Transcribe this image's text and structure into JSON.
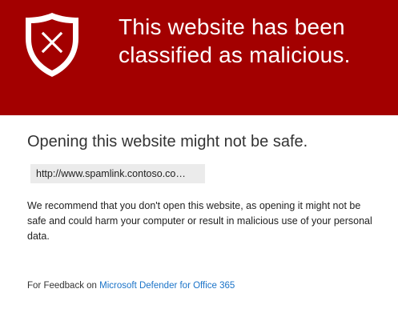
{
  "banner": {
    "title": "This website has been classified as malicious.",
    "icon": "shield-x-icon",
    "background_color": "#a30000"
  },
  "main": {
    "subtitle": "Opening this website might not be safe.",
    "url": "http://www.spamlink.contoso.co…",
    "message": "We recommend that you don't open this website, as opening it might not be safe and could harm your computer or result in malicious use of your personal data."
  },
  "footer": {
    "feedback_prefix": "For Feedback on ",
    "feedback_link": "Microsoft Defender for Office 365",
    "link_color": "#1a73c8"
  }
}
